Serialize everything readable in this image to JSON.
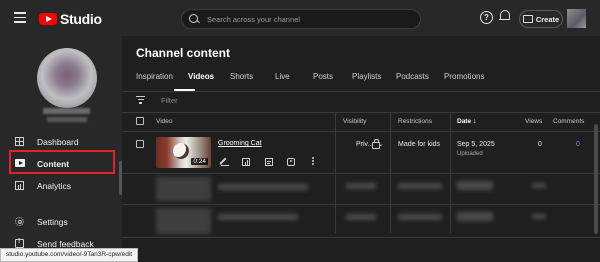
{
  "header": {
    "logo_text": "Studio",
    "search_placeholder": "Search across your channel",
    "create_label": "Create"
  },
  "sidebar": {
    "items": [
      {
        "label": "Dashboard"
      },
      {
        "label": "Content"
      },
      {
        "label": "Analytics"
      },
      {
        "label": "Settings"
      },
      {
        "label": "Send feedback"
      }
    ]
  },
  "main": {
    "title": "Channel content",
    "tabs": [
      "Inspiration",
      "Videos",
      "Shorts",
      "Live",
      "Posts",
      "Playlists",
      "Podcasts",
      "Promotions"
    ],
    "active_tab": "Videos",
    "filter_placeholder": "Filter",
    "columns": {
      "video": "Video",
      "visibility": "Visibility",
      "restrictions": "Restrictions",
      "date": "Date",
      "date_sort": "↓",
      "views": "Views",
      "comments": "Comments"
    },
    "rows": [
      {
        "title": "Grooming Cat",
        "duration": "0:24",
        "visibility": "Priv...",
        "restrictions": "Made for kids",
        "date": "Sep 5, 2025",
        "date_status": "Uploaded",
        "views": "0",
        "comments": "0"
      }
    ]
  },
  "status_bar": {
    "url": "studio.youtube.com/video/-9Tan3R-cpw/edit"
  },
  "colors": {
    "brand_red": "#ff0000",
    "highlight_red": "#e3202c",
    "link_blue": "#3ea6ff"
  }
}
